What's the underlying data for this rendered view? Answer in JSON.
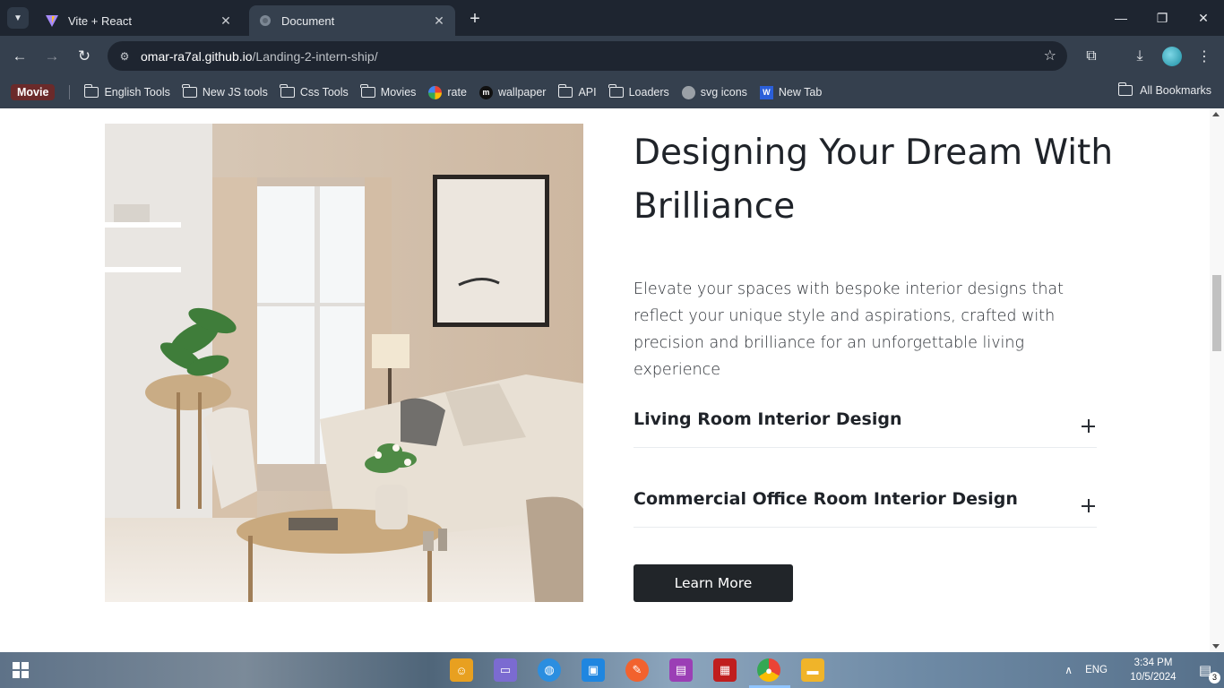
{
  "browser": {
    "tabs": [
      {
        "title": "Vite + React",
        "favicon": "vite-icon",
        "active": false
      },
      {
        "title": "Document",
        "favicon": "globe-icon",
        "active": true
      }
    ],
    "url_host": "omar-ra7al.github.io",
    "url_path": "/Landing-2-intern-ship/",
    "bookmarks": [
      {
        "label": "English Tools",
        "icon": "folder-icon"
      },
      {
        "label": "New JS tools",
        "icon": "folder-icon"
      },
      {
        "label": "Css Tools",
        "icon": "folder-icon"
      },
      {
        "label": "Movies",
        "icon": "folder-icon"
      },
      {
        "label": "rate",
        "icon": "google-icon"
      },
      {
        "label": "wallpaper",
        "icon": "m-icon"
      },
      {
        "label": "API",
        "icon": "folder-icon"
      },
      {
        "label": "Loaders",
        "icon": "folder-icon"
      },
      {
        "label": "svg icons",
        "icon": "globe-icon"
      },
      {
        "label": "New Tab",
        "icon": "w-icon"
      }
    ],
    "movie_bookmark": "Movie",
    "all_bookmarks": "All Bookmarks"
  },
  "page": {
    "heading": "Designing Your Dream With Brilliance",
    "description": "Elevate your spaces with bespoke interior designs that reflect your unique style and aspirations, crafted with precision and brilliance for an unforgettable living experience",
    "accordion": [
      {
        "title": "Living Room Interior Design"
      },
      {
        "title": "Commercial Office Room Interior Design"
      }
    ],
    "cta_label": "Learn More",
    "image_alt": "living room interior"
  },
  "taskbar": {
    "language": "ENG",
    "time": "3:34 PM",
    "date": "10/5/2024",
    "notification_count": "3"
  },
  "colors": {
    "button_bg": "#212529",
    "heading": "#1f2329"
  }
}
